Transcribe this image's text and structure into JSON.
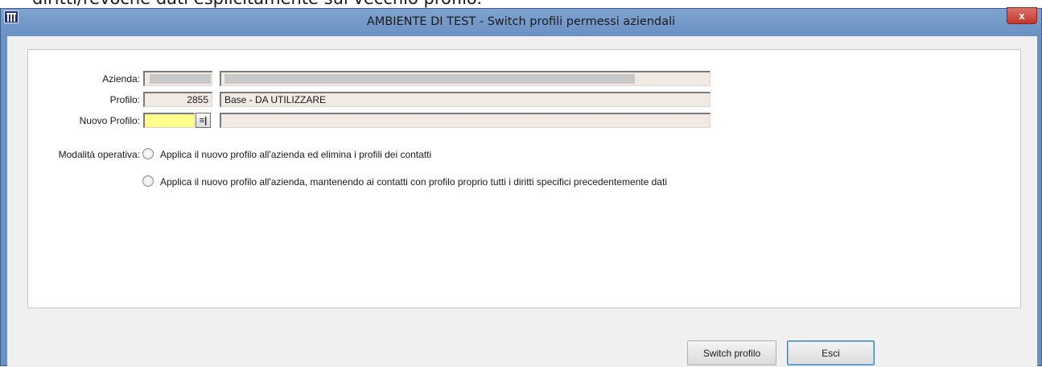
{
  "background": {
    "partial_text": "diritti/revoche dati esplicitamente sul vecchio profilo."
  },
  "window": {
    "title": "AMBIENTE DI TEST - Switch profili permessi aziendali",
    "close_label": "x"
  },
  "form": {
    "azienda_label": "Azienda:",
    "azienda_code": "",
    "azienda_name": "",
    "profilo_label": "Profilo:",
    "profilo_code": "2855",
    "profilo_name": "Base - DA UTILIZZARE",
    "nuovo_profilo_label": "Nuovo Profilo:",
    "nuovo_profilo_code": "",
    "nuovo_profilo_name": "",
    "lookup_button_glyph": "≡|"
  },
  "modalita": {
    "label": "Modalità operativa:",
    "options": [
      {
        "label": "Applica il nuovo profilo all'azienda ed elimina i profili dei contatti",
        "selected": false
      },
      {
        "label": "Applica il nuovo profilo all'azienda, mantenendo ai contatti con profilo proprio tutti i diritti specifici precedentemente dati",
        "selected": false
      }
    ]
  },
  "buttons": {
    "switch_label": "Switch profilo",
    "esci_label": "Esci"
  },
  "colors": {
    "titlebar": "#6b92c3",
    "field_bg": "#f0e9e4",
    "required_field": "#ffff90",
    "close_button": "#c0392b"
  }
}
